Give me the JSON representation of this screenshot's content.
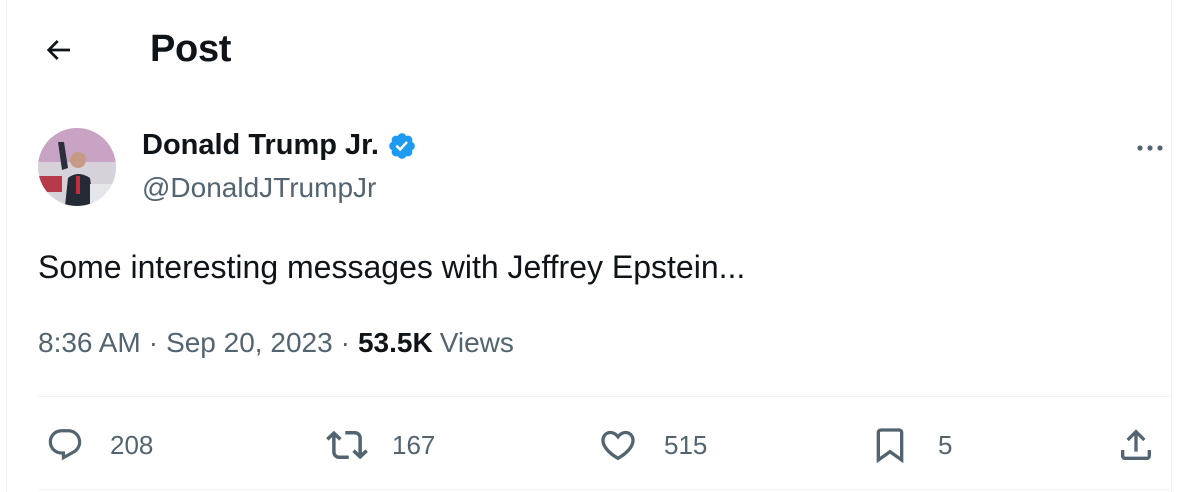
{
  "header": {
    "title": "Post"
  },
  "post": {
    "author_name": "Donald Trump Jr.",
    "handle": "@DonaldJTrumpJr",
    "text": "Some interesting messages with Jeffrey Epstein...",
    "time": "8:36 AM",
    "date": "Sep 20, 2023",
    "separator": "·",
    "views_count": "53.5K",
    "views_label": "Views"
  },
  "actions": {
    "replies": "208",
    "reposts": "167",
    "likes": "515",
    "bookmarks": "5"
  },
  "icons": {
    "back": "arrow-left-icon",
    "verified": "verified-badge-icon",
    "more": "more-horizontal-icon",
    "reply": "reply-icon",
    "repost": "repost-icon",
    "like": "heart-icon",
    "bookmark": "bookmark-icon",
    "share": "share-icon"
  },
  "colors": {
    "verified": "#1d9bf0",
    "secondary_text": "#536471",
    "primary_text": "#0f1419"
  }
}
